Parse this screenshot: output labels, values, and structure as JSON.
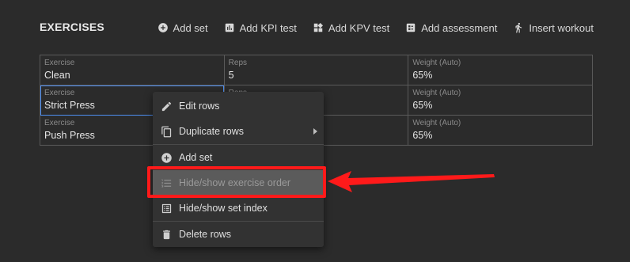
{
  "section": {
    "title": "EXERCISES"
  },
  "toolbar": {
    "buttons": [
      {
        "label": "Add set",
        "icon": "plus-circle-icon"
      },
      {
        "label": "Add KPI test",
        "icon": "bar-chart-icon"
      },
      {
        "label": "Add KPV test",
        "icon": "widgets-icon"
      },
      {
        "label": "Add assessment",
        "icon": "assessment-icon"
      },
      {
        "label": "Insert workout",
        "icon": "insert-workout-icon"
      }
    ]
  },
  "table": {
    "rows": [
      {
        "exercise_label": "Exercise",
        "exercise": "Clean",
        "reps_label": "Reps",
        "reps": "5",
        "weight_label": "Weight (Auto)",
        "weight": "65%"
      },
      {
        "exercise_label": "Exercise",
        "exercise": "Strict Press",
        "reps_label": "Reps",
        "reps": "",
        "weight_label": "Weight (Auto)",
        "weight": "65%"
      },
      {
        "exercise_label": "Exercise",
        "exercise": "Push Press",
        "reps_label": "",
        "reps": "",
        "weight_label": "Weight (Auto)",
        "weight": "65%"
      }
    ]
  },
  "context_menu": {
    "items": [
      {
        "label": "Edit rows",
        "icon": "pencil-icon"
      },
      {
        "label": "Duplicate rows",
        "icon": "copy-icon",
        "has_submenu": true
      },
      {
        "label": "Add set",
        "icon": "plus-circle-icon"
      },
      {
        "label": "Hide/show exercise order",
        "icon": "ordered-list-icon",
        "highlighted": true
      },
      {
        "label": "Hide/show set index",
        "icon": "list-alt-icon"
      },
      {
        "label": "Delete rows",
        "icon": "trash-icon"
      }
    ]
  },
  "annotation": {
    "color": "#ff1a1a"
  }
}
